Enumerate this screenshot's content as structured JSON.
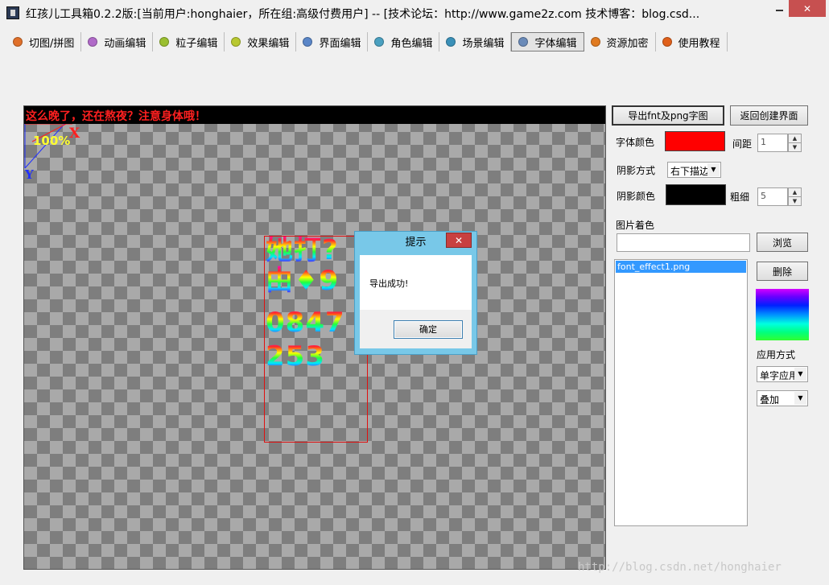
{
  "window": {
    "title": "红孩儿工具箱0.2.2版:[当前用户:honghaier，所在组:高级付费用户]  --  [技术论坛：http://www.game2z.com 技术博客：blog.csd...",
    "close_glyph": "✕"
  },
  "toolbar": {
    "tabs": [
      {
        "label": "切图/拼图",
        "icon": "orange-gem-icon",
        "color": "#e0702a"
      },
      {
        "label": "动画编辑",
        "icon": "purple-gem-icon",
        "color": "#b06ac8"
      },
      {
        "label": "粒子编辑",
        "icon": "green-gem-icon",
        "color": "#9abf30"
      },
      {
        "label": "效果编辑",
        "icon": "green-gem-icon",
        "color": "#b8c830"
      },
      {
        "label": "界面编辑",
        "icon": "blue-gem-icon",
        "color": "#5a86c8"
      },
      {
        "label": "角色编辑",
        "icon": "teal-gem-icon",
        "color": "#4aa0c0"
      },
      {
        "label": "场景编辑",
        "icon": "teal-gem-icon",
        "color": "#3a90b8"
      },
      {
        "label": "字体编辑",
        "icon": "blue-gem-icon",
        "color": "#6a8ab8"
      },
      {
        "label": "资源加密",
        "icon": "orange-gem-icon",
        "color": "#e07a20"
      },
      {
        "label": "使用教程",
        "icon": "orange-gem-icon",
        "color": "#e0601a"
      }
    ],
    "active_tab": "字体编辑"
  },
  "canvas": {
    "warning": "这么晚了，还在熬夜？注意身体哦！",
    "zoom": "100%",
    "axis_x": "X",
    "axis_y": "Y",
    "glyph_rows": [
      "她打?",
      "由♦9",
      "0847",
      "253"
    ]
  },
  "dialog": {
    "title": "提示",
    "message": "导出成功!",
    "ok_label": "确定",
    "close_glyph": "✕"
  },
  "panel": {
    "export_button": "导出fnt及png字图",
    "back_button": "返回创建界面",
    "font_color_label": "字体颜色",
    "font_color": "#ff0000",
    "spacing_label": "间距",
    "spacing_value": "1",
    "shadow_mode_label": "阴影方式",
    "shadow_mode_value": "右下描边",
    "shadow_color_label": "阴影颜色",
    "shadow_color": "#000000",
    "thickness_label": "粗细",
    "thickness_value": "5",
    "image_tint_label": "图片着色",
    "image_path_value": "",
    "browse_button": "浏览",
    "files": [
      "font_effect1.png"
    ],
    "delete_button": "删除",
    "apply_mode_label": "应用方式",
    "apply_mode_value": "单字应用",
    "blend_mode_value": "叠加"
  },
  "watermark": "http://blog.csdn.net/honghaier"
}
